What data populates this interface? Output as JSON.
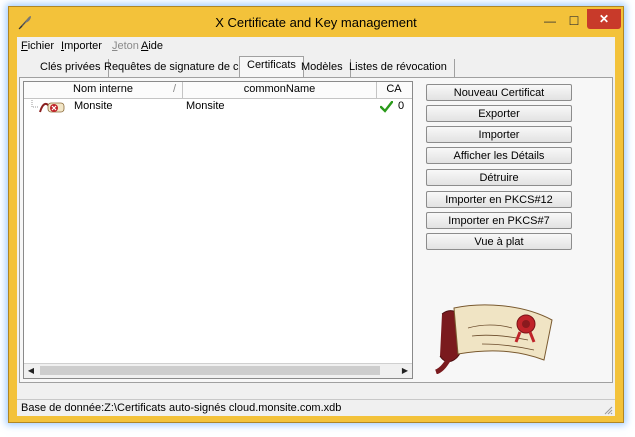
{
  "window": {
    "title": "X Certificate and Key management",
    "minimize_glyph": "—",
    "maximize_glyph": "☐",
    "close_glyph": "✕"
  },
  "menu": {
    "items": [
      {
        "label": "Fichier",
        "enabled": true
      },
      {
        "label": "Importer",
        "enabled": true
      },
      {
        "label": "Jeton",
        "enabled": false
      },
      {
        "label": "Aide",
        "enabled": true
      }
    ]
  },
  "tabs": [
    {
      "label": "Clés privées",
      "active": false
    },
    {
      "label": "Requêtes de signature de certificat",
      "active": false
    },
    {
      "label": "Certificats",
      "active": true
    },
    {
      "label": "Modèles",
      "active": false
    },
    {
      "label": "Listes de révocation",
      "active": false
    }
  ],
  "table": {
    "columns": [
      "Nom interne",
      "commonName",
      "CA"
    ],
    "sort_indicator": "/",
    "rows": [
      {
        "internal_name": "Monsite",
        "common_name": "Monsite",
        "ca_count": "0",
        "ca_icon": "check-icon"
      }
    ]
  },
  "scrollbar": {
    "left_glyph": "◀",
    "right_glyph": "▶"
  },
  "actions": [
    {
      "label": "Nouveau Certificat"
    },
    {
      "label": "Exporter"
    },
    {
      "label": "Importer"
    },
    {
      "label": "Afficher les Détails"
    },
    {
      "label": "Détruire"
    },
    {
      "label": "Importer en PKCS#12"
    },
    {
      "label": "Importer en PKCS#7"
    },
    {
      "label": "Vue à plat"
    }
  ],
  "status": {
    "text": "Base de donnée:Z:\\Certificats auto-signés cloud.monsite.com.xdb"
  },
  "colors": {
    "frame": "#f3c23a",
    "close_button": "#c83a2a",
    "check": "#2a9a1a",
    "seal": "#c0242a"
  }
}
